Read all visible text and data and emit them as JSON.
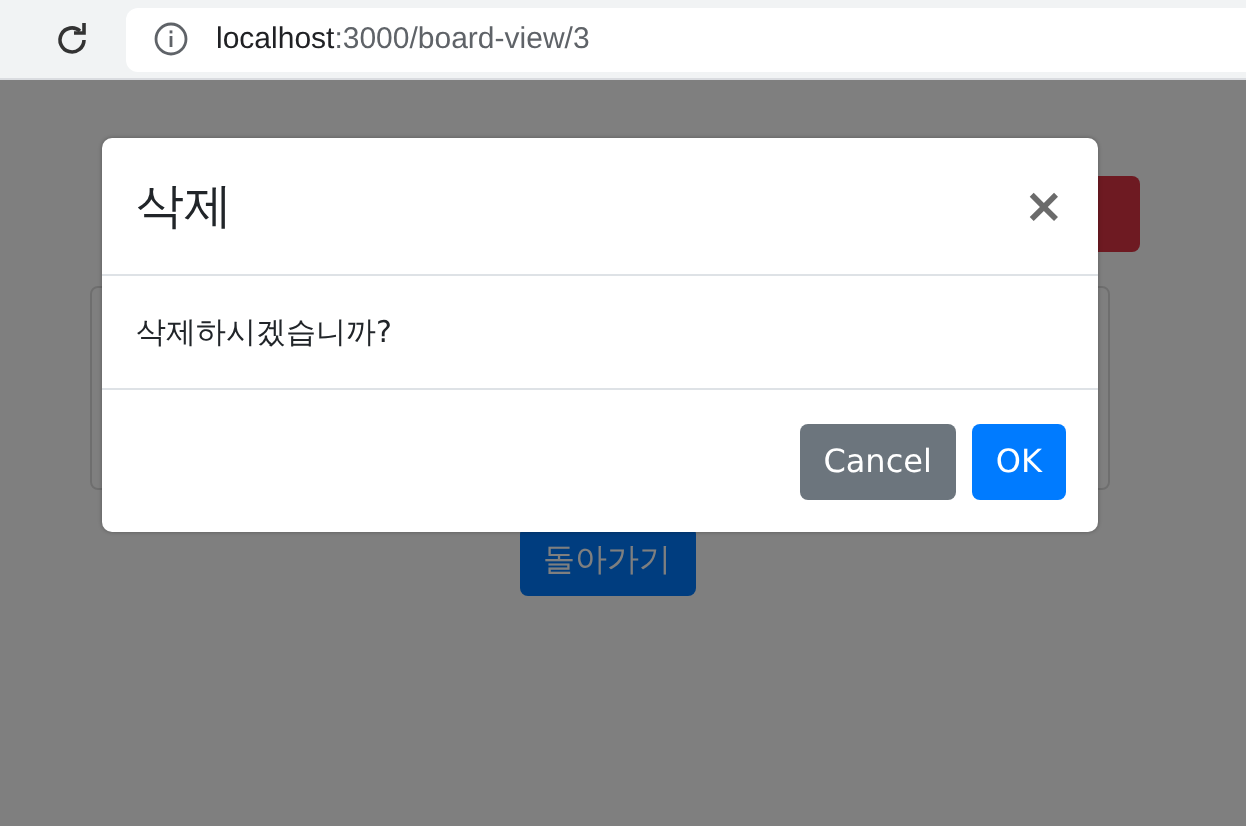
{
  "browser": {
    "url_host": "localhost",
    "url_path": ":3000/board-view/3"
  },
  "page": {
    "top_button": {
      "kind": "danger"
    },
    "back_button": "돌아가기"
  },
  "modal": {
    "title": "삭제",
    "close": "×",
    "message": "삭제하시겠습니까?",
    "buttons": [
      {
        "label": "Cancel",
        "kind": "secondary"
      },
      {
        "label": "OK",
        "kind": "primary"
      }
    ]
  }
}
